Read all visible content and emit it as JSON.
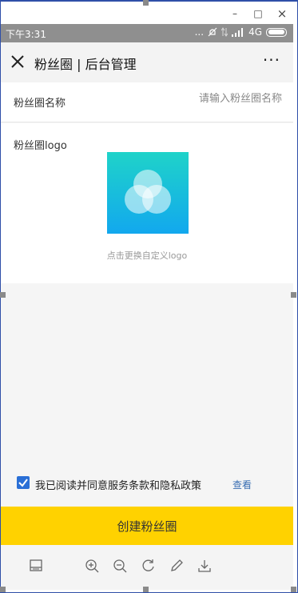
{
  "window": {
    "minimize": "–",
    "maximize": "□",
    "close": "×"
  },
  "statusbar": {
    "time": "下午3:31",
    "dots": "...",
    "network": "4G"
  },
  "header": {
    "title": "粉丝圈 | 后台管理",
    "more": "···"
  },
  "form": {
    "name_label": "粉丝圈名称",
    "name_placeholder": "请输入粉丝圈名称",
    "logo_label": "粉丝圈logo",
    "logo_caption": "点击更换自定义logo"
  },
  "agreement": {
    "checked": true,
    "text": "我已阅读并同意服务条款和隐私政策",
    "link": "查看"
  },
  "submit": {
    "label": "创建粉丝圈"
  },
  "toolbar": {
    "icons": [
      "panel-icon",
      "zoom-in-icon",
      "zoom-out-icon",
      "rotate-icon",
      "edit-icon",
      "download-icon"
    ]
  },
  "colors": {
    "accent": "#ffd200",
    "link": "#3a6fb3",
    "checkbox": "#2a6fd6",
    "status_bar": "#8f8f8f"
  }
}
